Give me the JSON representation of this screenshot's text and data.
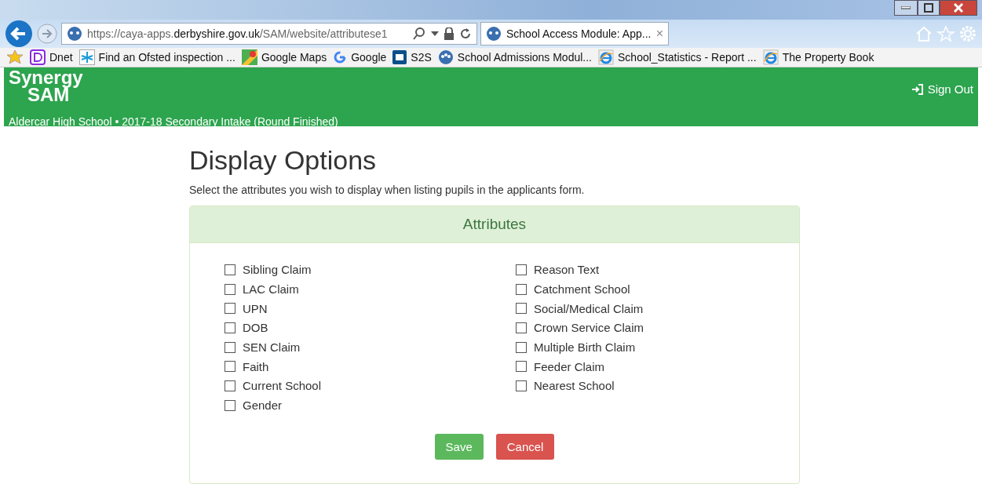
{
  "browser": {
    "url": "https://caya-apps.**derbyshire.gov.uk**/SAM/website/attributese1",
    "tab": {
      "title": "School Access Module: App...",
      "close": "×",
      "selected": true
    },
    "favorites": [
      {
        "label": "Dnet",
        "kind": "d"
      },
      {
        "label": "Find an Ofsted inspection ...",
        "kind": "star"
      },
      {
        "label": "Google Maps",
        "kind": "maps"
      },
      {
        "label": "Google",
        "kind": "g"
      },
      {
        "label": "S2S",
        "kind": "dfe"
      },
      {
        "label": "School Admissions Modul...",
        "kind": "sam"
      },
      {
        "label": "School_Statistics - Report ...",
        "kind": "ie"
      },
      {
        "label": "The Property Book",
        "kind": "ie"
      }
    ]
  },
  "header": {
    "logo_line1": "Synergy",
    "logo_line2": "SAM",
    "context": "Aldercar High School • 2017-18 Secondary Intake (Round Finished)",
    "sign_out": "Sign Out"
  },
  "page": {
    "title": "Display Options",
    "description": "Select the attributes you wish to display when listing pupils in the applicants form.",
    "panel_title": "Attributes",
    "columns": [
      [
        {
          "label": "Sibling Claim",
          "checked": false
        },
        {
          "label": "LAC Claim",
          "checked": false
        },
        {
          "label": "UPN",
          "checked": false
        },
        {
          "label": "DOB",
          "checked": false
        },
        {
          "label": "SEN Claim",
          "checked": false
        },
        {
          "label": "Faith",
          "checked": false
        },
        {
          "label": "Current School",
          "checked": false
        },
        {
          "label": "Gender",
          "checked": false
        }
      ],
      [
        {
          "label": "Reason Text",
          "checked": false
        },
        {
          "label": "Catchment School",
          "checked": false
        },
        {
          "label": "Social/Medical Claim",
          "checked": false
        },
        {
          "label": "Crown Service Claim",
          "checked": false
        },
        {
          "label": "Multiple Birth Claim",
          "checked": false
        },
        {
          "label": "Feeder Claim",
          "checked": false
        },
        {
          "label": "Nearest School",
          "checked": false
        }
      ]
    ],
    "buttons": [
      {
        "label": "Save",
        "kind": "primary"
      },
      {
        "label": "Cancel",
        "kind": "danger"
      }
    ]
  }
}
